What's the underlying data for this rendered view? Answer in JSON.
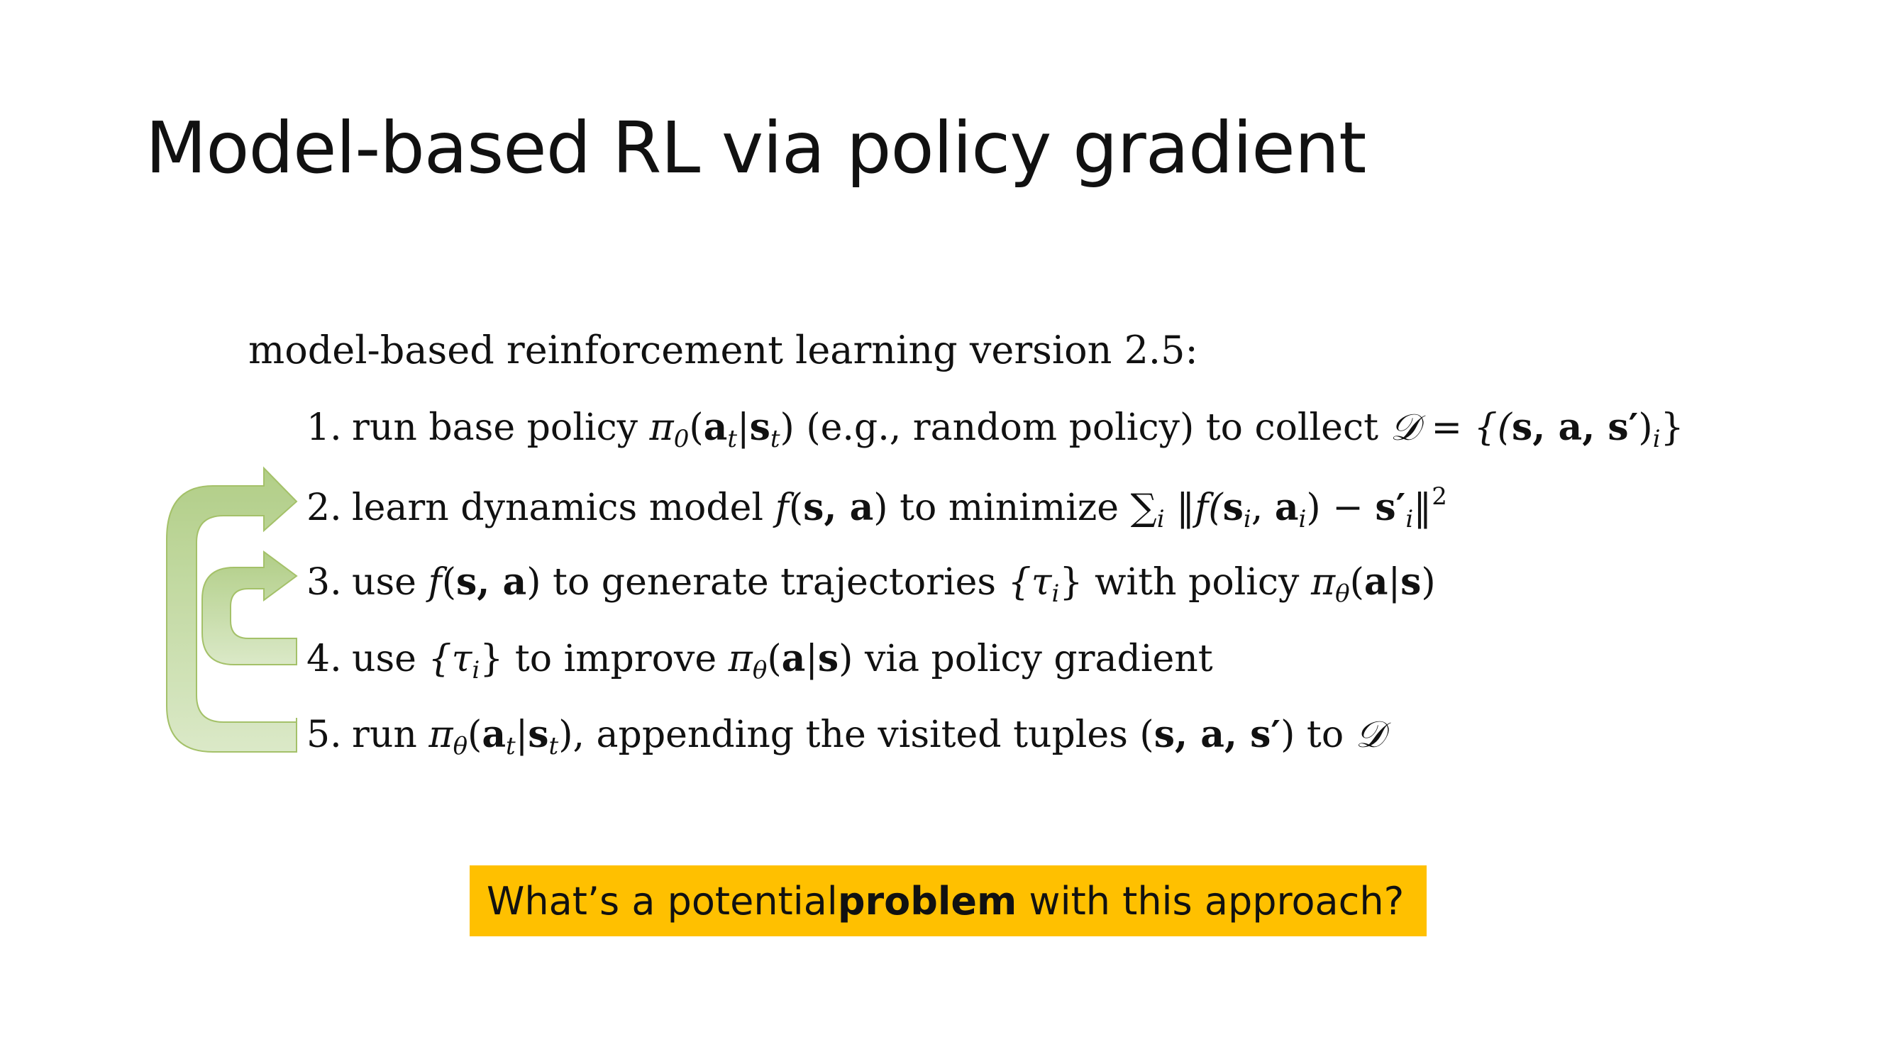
{
  "slide": {
    "title": "Model-based RL via policy gradient",
    "heading": "model-based reinforcement learning version 2.5:"
  },
  "steps": [
    {
      "num": "1.",
      "t1": "run base policy ",
      "m1": "π",
      "s1": "0",
      "m2": "(",
      "b1": "a",
      "s2": "t",
      "m3": "|",
      "b2": "s",
      "s3": "t",
      "m4": ")",
      "t2": " (e.g., random policy) to collect ",
      "m5": "𝒟 = {(",
      "b3": "s, a, s′",
      "m6": ")",
      "s4": "i",
      "m7": "}"
    },
    {
      "num": "2.",
      "t1": "learn dynamics model ",
      "m1": "f",
      "m2": "(",
      "b1": "s, a",
      "m3": ")",
      "t2": " to minimize ",
      "m4": "∑",
      "s1": "i",
      "m5": " ‖f(",
      "b2": "s",
      "s2": "i",
      "m6": ", ",
      "b3": "a",
      "s3": "i",
      "m7": ") − ",
      "b4": "s′",
      "s4": "i",
      "m8": "‖",
      "sup": "2"
    },
    {
      "num": "3.",
      "t1": "use ",
      "m1": "f",
      "m2": "(",
      "b1": "s, a",
      "m3": ")",
      "t2": " to generate trajectories ",
      "m4": "{τ",
      "s1": "i",
      "m5": "}",
      "t3": " with policy ",
      "m6": "π",
      "s2": "θ",
      "m7": "(",
      "b2": "a",
      "m8": "|",
      "b3": "s",
      "m9": ")"
    },
    {
      "num": "4.",
      "t1": "use ",
      "m1": "{τ",
      "s1": "i",
      "m2": "}",
      "t2": " to improve ",
      "m3": "π",
      "s2": "θ",
      "m4": "(",
      "b1": "a",
      "m5": "|",
      "b2": "s",
      "m6": ")",
      "t3": " via policy gradient"
    },
    {
      "num": "5.",
      "t1": "run ",
      "m1": "π",
      "s1": "θ",
      "m2": "(",
      "b1": "a",
      "s2": "t",
      "m3": "|",
      "b2": "s",
      "s3": "t",
      "m4": ")",
      "t2": ", appending the visited tuples ",
      "m5": "(",
      "b3": "s, a, s′",
      "m6": ")",
      "t3": " to ",
      "m7": "𝒟"
    }
  ],
  "callout": {
    "pre": "What’s a potential ",
    "bold": "problem",
    "post": " with this approach?"
  },
  "colors": {
    "arrow_fill": "#c5dba4",
    "arrow_stroke": "#9bbb59",
    "callout_bg": "#ffc000"
  }
}
